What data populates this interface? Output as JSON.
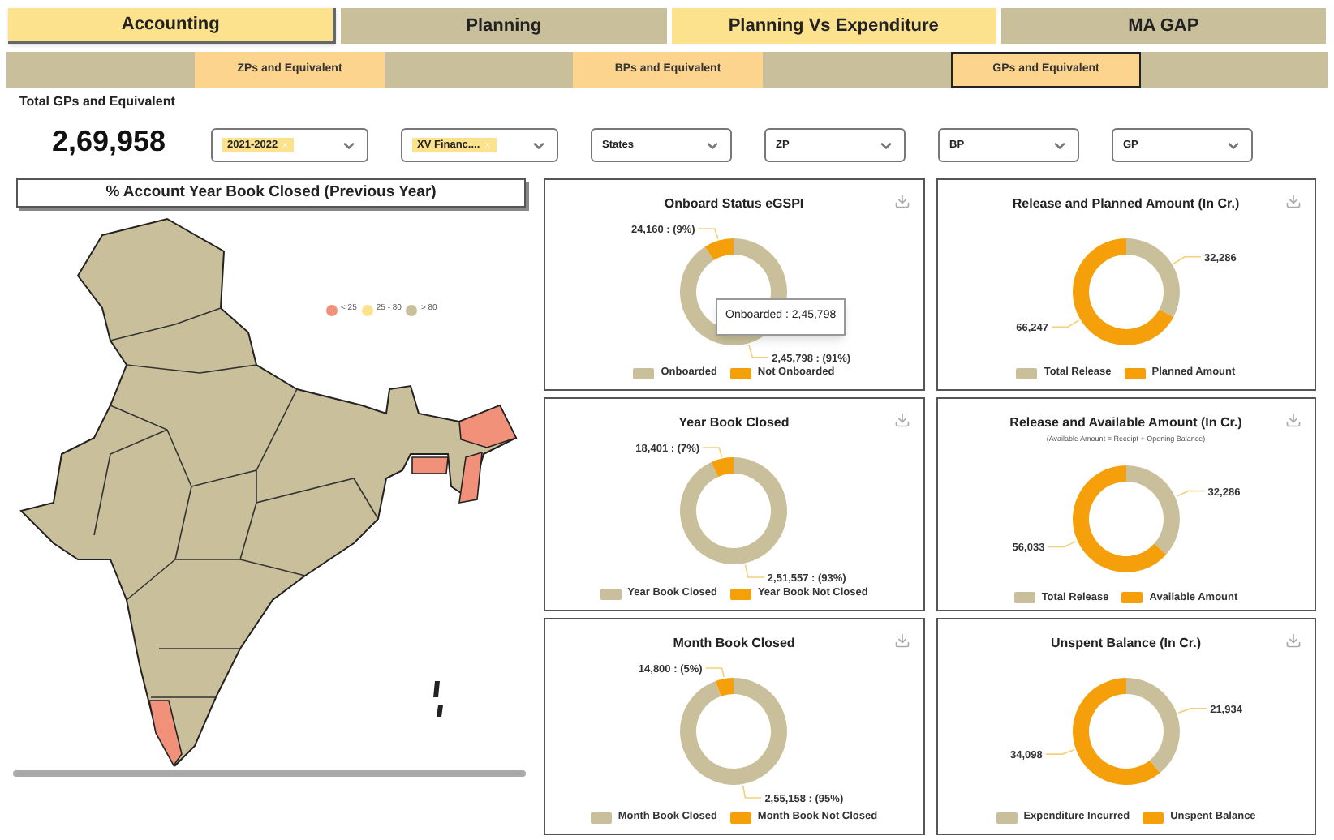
{
  "nav_tabs": [
    {
      "label": "Accounting",
      "selected": true,
      "color": "#fde28e"
    },
    {
      "label": "Planning",
      "selected": false,
      "color": "#c9c09b"
    },
    {
      "label": "Planning Vs Expenditure",
      "selected": false,
      "color": "#fde28e"
    },
    {
      "label": "MA GAP",
      "selected": false,
      "color": "#c9c09b"
    }
  ],
  "sub_tabs": [
    {
      "label": "ZPs and Equivalent",
      "selected": false
    },
    {
      "label": "BPs and Equivalent",
      "selected": false
    },
    {
      "label": "GPs and Equivalent",
      "selected": true
    }
  ],
  "total": {
    "label": "Total GPs and Equivalent",
    "value": "2,69,958"
  },
  "filters": [
    {
      "kind": "chips",
      "chips": [
        "2021-2022"
      ]
    },
    {
      "kind": "chips",
      "chips": [
        "XV Financ...."
      ]
    },
    {
      "kind": "plain",
      "placeholder": "States"
    },
    {
      "kind": "plain",
      "placeholder": "ZP"
    },
    {
      "kind": "plain",
      "placeholder": "BP"
    },
    {
      "kind": "plain",
      "placeholder": "GP"
    }
  ],
  "map": {
    "title": "% Account Year Book Closed (Previous Year)",
    "legend": [
      {
        "label": "< 25",
        "color": "#f2917a"
      },
      {
        "label": "25 - 80",
        "color": "#fde28e"
      },
      {
        "label": "> 80",
        "color": "#c9c09b"
      }
    ]
  },
  "panels": [
    {
      "title": "Onboard Status eGSPI",
      "tooltip": "Onboarded : 2,45,798",
      "legend": [
        {
          "color": "#c9c09b"
        },
        {
          "color": "#f5a00a"
        }
      ],
      "chart_data": {
        "type": "donut",
        "categories": [
          "Onboarded",
          "Not Onboarded"
        ],
        "values": [
          245798,
          24160
        ],
        "value_labels": [
          "2,45,798 : (91%)",
          "24,160 : (9%)"
        ]
      }
    },
    {
      "title": "Release and Planned Amount (In Cr.)",
      "legend": [
        {
          "color": "#c9c09b"
        },
        {
          "color": "#f5a00a"
        }
      ],
      "chart_data": {
        "type": "donut",
        "categories": [
          "Total Release",
          "Planned Amount"
        ],
        "values": [
          32286,
          66247
        ],
        "value_labels": [
          "32,286",
          "66,247"
        ]
      }
    },
    {
      "title": "Year Book Closed",
      "legend": [
        {
          "color": "#c9c09b"
        },
        {
          "color": "#f5a00a"
        }
      ],
      "chart_data": {
        "type": "donut",
        "categories": [
          "Year Book Closed",
          "Year Book Not Closed"
        ],
        "values": [
          251557,
          18401
        ],
        "value_labels": [
          "2,51,557 : (93%)",
          "18,401 : (7%)"
        ]
      }
    },
    {
      "title": "Release and Available Amount (In Cr.)",
      "subtitle": "(Available Amount = Receipt + Opening Balance)",
      "legend": [
        {
          "color": "#c9c09b"
        },
        {
          "color": "#f5a00a"
        }
      ],
      "chart_data": {
        "type": "donut",
        "categories": [
          "Total Release",
          "Available Amount"
        ],
        "values": [
          32286,
          56033
        ],
        "value_labels": [
          "32,286",
          "56,033"
        ]
      }
    },
    {
      "title": "Month Book Closed",
      "legend": [
        {
          "color": "#c9c09b"
        },
        {
          "color": "#f5a00a"
        }
      ],
      "chart_data": {
        "type": "donut",
        "categories": [
          "Month Book Closed",
          "Month Book Not Closed"
        ],
        "values": [
          255158,
          14800
        ],
        "value_labels": [
          "2,55,158 : (95%)",
          "14,800 : (5%)"
        ]
      }
    },
    {
      "title": "Unspent Balance (In Cr.)",
      "legend": [
        {
          "color": "#c9c09b"
        },
        {
          "color": "#f5a00a"
        }
      ],
      "chart_data": {
        "type": "donut",
        "categories": [
          "Expenditure Incurred",
          "Unspent Balance"
        ],
        "values": [
          21934,
          34098
        ],
        "value_labels": [
          "21,934",
          "34,098"
        ]
      }
    }
  ]
}
